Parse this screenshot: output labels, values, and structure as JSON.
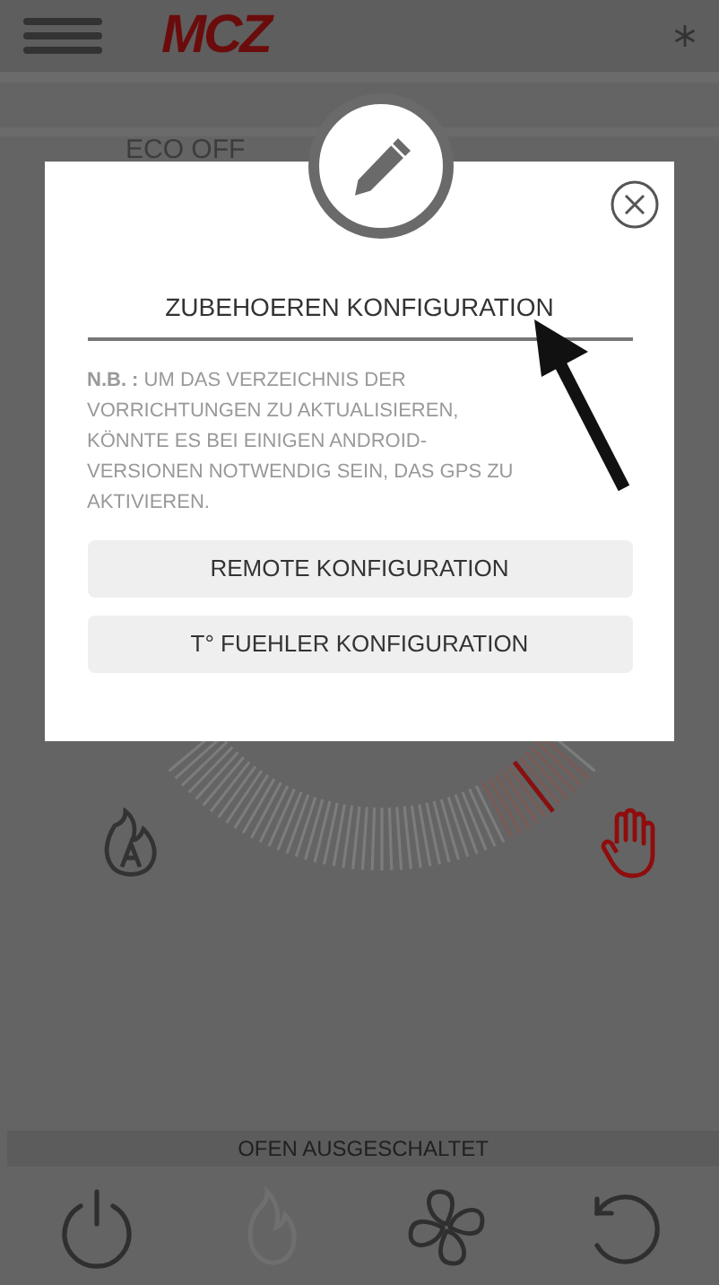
{
  "header": {
    "logo": "MCZ"
  },
  "background": {
    "tab_label": "ECO OFF",
    "modes": [
      {
        "kind": "auto",
        "selected": false
      },
      {
        "kind": "manual",
        "selected": true
      }
    ],
    "status": "OFEN AUSGESCHALTET",
    "toolbar": [
      {
        "kind": "power",
        "disabled": false
      },
      {
        "kind": "flame",
        "disabled": true
      },
      {
        "kind": "fan",
        "disabled": false
      },
      {
        "kind": "reset",
        "disabled": false
      }
    ]
  },
  "dialog": {
    "title": "ZUBEHOEREN KONFIGURATION",
    "note": "**N.B. :** UM DAS VERZEICHNIS DER VORRICHTUNGEN ZU AKTUALISIEREN, KÖNNTE ES BEI EINIGEN ANDROID-VERSIONEN NOTWENDIG SEIN, DAS GPS ZU AKTIVIEREN.",
    "buttons": [
      "REMOTE KONFIGURATION",
      "T° FUEHLER KONFIGURATION"
    ]
  }
}
